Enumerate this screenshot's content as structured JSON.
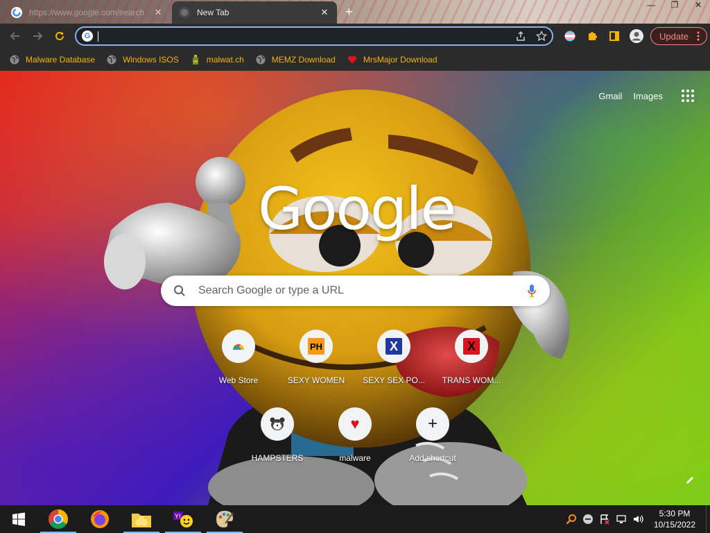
{
  "browser": {
    "tabs": [
      {
        "title": "https://www.google.com/search",
        "active": false
      },
      {
        "title": "New Tab",
        "active": true
      }
    ],
    "new_tab_symbol": "+",
    "tab_close_symbol": "✕",
    "window_controls": [
      "—",
      "❐",
      "✕"
    ],
    "omnibox": {
      "value": "",
      "placeholder": ""
    },
    "update_label": "Update",
    "bookmarks": [
      {
        "label": "Malware Database",
        "icon": "globe-icon"
      },
      {
        "label": "Windows ISOS",
        "icon": "globe-icon"
      },
      {
        "label": "malwat.ch",
        "icon": "bottle-icon"
      },
      {
        "label": "MEMZ Download",
        "icon": "globe-icon"
      },
      {
        "label": "MrsMajor Download",
        "icon": "heart-icon"
      }
    ]
  },
  "newtab": {
    "links": {
      "gmail": "Gmail",
      "images": "Images"
    },
    "logo": "Google",
    "search_placeholder": "Search Google or type a URL",
    "shortcuts": [
      {
        "label": "Web Store",
        "icon": "webstore-icon"
      },
      {
        "label": "SEXY WOMEN",
        "icon": "ph-icon",
        "glyph": "PH"
      },
      {
        "label": "SEXY SEX PO...",
        "icon": "x-blue-icon",
        "glyph": "X"
      },
      {
        "label": "TRANS WOM...",
        "icon": "x-red-icon",
        "glyph": "X"
      },
      {
        "label": "HAMPSTERS",
        "icon": "hamster-icon"
      },
      {
        "label": "malware",
        "icon": "heart-icon",
        "glyph": "♥"
      },
      {
        "label": "Add shortcut",
        "icon": "plus-icon",
        "glyph": "+"
      }
    ]
  },
  "taskbar": {
    "apps": [
      "windows-start-icon",
      "chrome-icon",
      "firefox-icon",
      "file-explorer-icon",
      "yahoo-messenger-icon",
      "paint-icon"
    ],
    "clock": {
      "time": "5:30 PM",
      "date": "10/15/2022"
    }
  },
  "colors": {
    "accent": "#8ab4f8",
    "bookmark_text": "#f5b400",
    "update": "#f28b82",
    "toolbar": "#2b2b2b",
    "taskbar": "#1c1c1c"
  }
}
